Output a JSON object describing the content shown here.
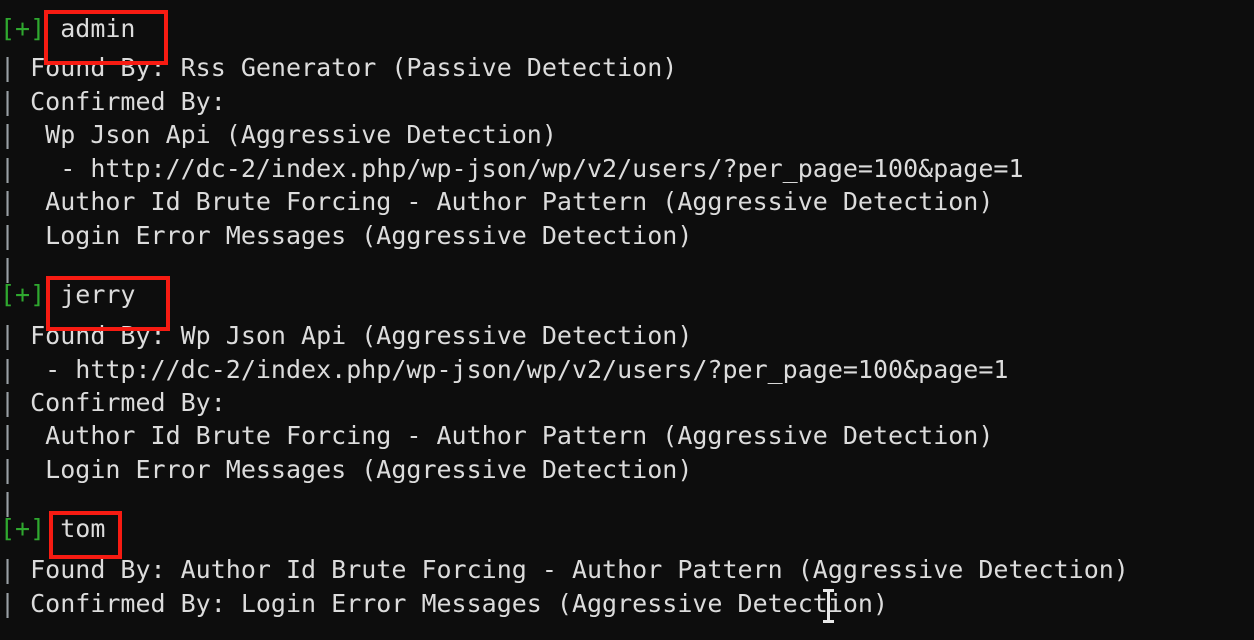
{
  "terminal": {
    "background_color": "#0d0d0d",
    "text_color": "#dcdcdc",
    "marker_color": "#2fa82f",
    "annotation_color": "#f71b12",
    "pipe_char": "|",
    "marker_label": "[+]"
  },
  "lines": [
    {
      "id": "l1",
      "marker": "[+]",
      "text": ""
    },
    {
      "id": "l2",
      "pipe": "|",
      "text": " Found By: Rss Generator (Passive Detection)"
    },
    {
      "id": "l3",
      "pipe": "|",
      "text": " Confirmed By:"
    },
    {
      "id": "l4",
      "pipe": "|",
      "text": "  Wp Json Api (Aggressive Detection)"
    },
    {
      "id": "l5",
      "pipe": "|",
      "text": "   - http://dc-2/index.php/wp-json/wp/v2/users/?per_page=100&page=1"
    },
    {
      "id": "l6",
      "pipe": "|",
      "text": "  Author Id Brute Forcing - Author Pattern (Aggressive Detection)"
    },
    {
      "id": "l7",
      "pipe": "|",
      "text": "  Login Error Messages (Aggressive Detection)"
    },
    {
      "id": "l8",
      "pipe": "|",
      "text": ""
    },
    {
      "id": "l9",
      "marker": "[+]",
      "text": ""
    },
    {
      "id": "l10",
      "pipe": "|",
      "text": " Found By: Wp Json Api (Aggressive Detection)"
    },
    {
      "id": "l11",
      "pipe": "|",
      "text": "  - http://dc-2/index.php/wp-json/wp/v2/users/?per_page=100&page=1"
    },
    {
      "id": "l12",
      "pipe": "|",
      "text": " Confirmed By:"
    },
    {
      "id": "l13",
      "pipe": "|",
      "text": "  Author Id Brute Forcing - Author Pattern (Aggressive Detection)"
    },
    {
      "id": "l14",
      "pipe": "|",
      "text": "  Login Error Messages (Aggressive Detection)"
    },
    {
      "id": "l15",
      "pipe": "|",
      "text": ""
    },
    {
      "id": "l16",
      "marker": "[+]",
      "text": ""
    },
    {
      "id": "l17",
      "pipe": "|",
      "text": " Found By: Author Id Brute Forcing - Author Pattern (Aggressive Detection)"
    },
    {
      "id": "l18",
      "pipe": "|",
      "text": " Confirmed By: Login Error Messages (Aggressive Detection)"
    }
  ],
  "users": {
    "admin": {
      "name": "admin"
    },
    "jerry": {
      "name": "jerry"
    },
    "tom": {
      "name": "tom"
    }
  },
  "annotations": [
    {
      "target": "admin"
    },
    {
      "target": "jerry"
    },
    {
      "target": "tom"
    }
  ]
}
